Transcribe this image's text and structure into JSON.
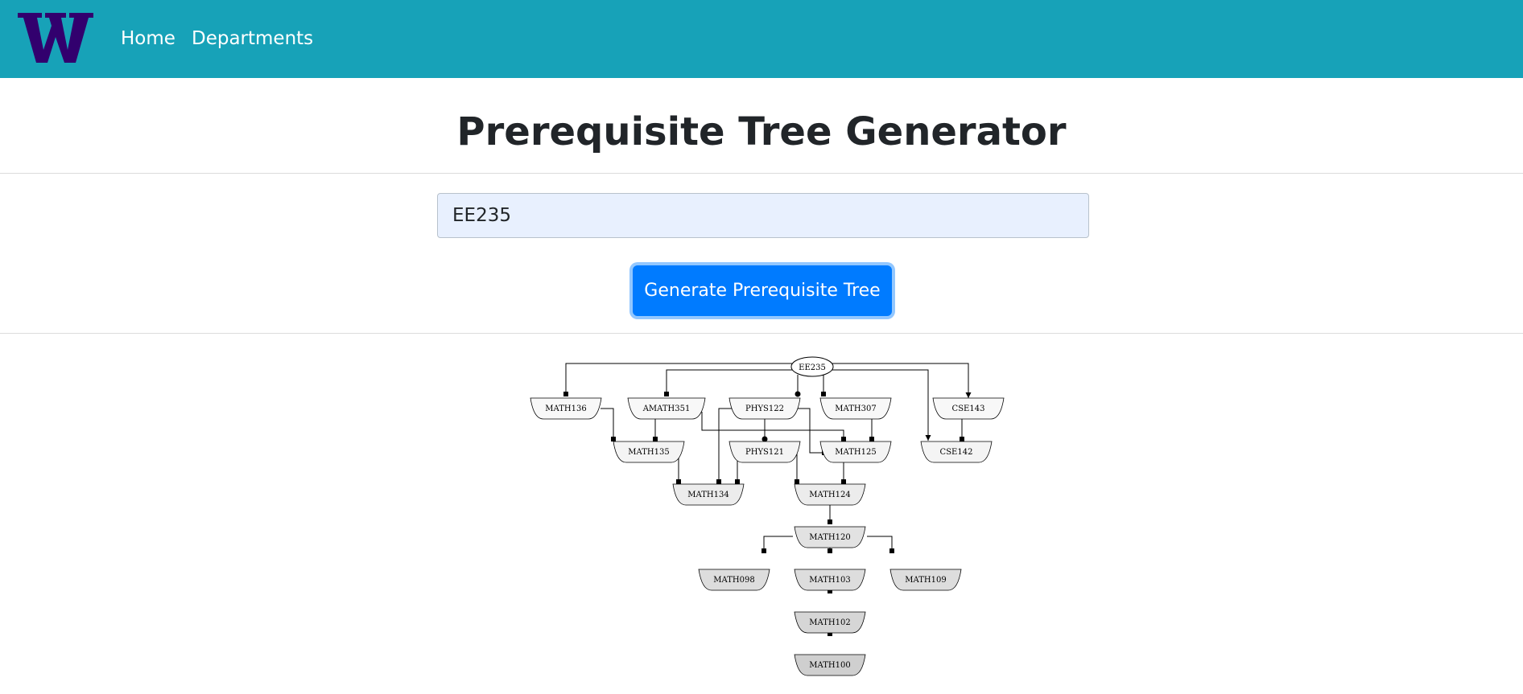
{
  "nav": {
    "logo_alt": "W",
    "home_label": "Home",
    "departments_label": "Departments",
    "brand_color": "#17a2b8",
    "logo_color": "#32006e"
  },
  "page": {
    "title": "Prerequisite Tree Generator"
  },
  "form": {
    "course_value": "EE235",
    "button_label": "Generate Prerequisite Tree",
    "button_color": "#007bff"
  },
  "tree": {
    "root": "EE235",
    "nodes": [
      "MATH136",
      "AMATH351",
      "PHYS122",
      "MATH307",
      "CSE143",
      "MATH135",
      "PHYS121",
      "MATH125",
      "CSE142",
      "MATH134",
      "MATH124",
      "MATH120",
      "MATH098",
      "MATH103",
      "MATH109",
      "MATH102",
      "MATH100"
    ],
    "edges": [
      {
        "from": "EE235",
        "to": "MATH136"
      },
      {
        "from": "EE235",
        "to": "AMATH351"
      },
      {
        "from": "EE235",
        "to": "PHYS122"
      },
      {
        "from": "EE235",
        "to": "MATH307"
      },
      {
        "from": "EE235",
        "to": "CSE143"
      },
      {
        "from": "EE235",
        "to": "CSE142"
      },
      {
        "from": "MATH136",
        "to": "MATH135"
      },
      {
        "from": "AMATH351",
        "to": "MATH135"
      },
      {
        "from": "AMATH351",
        "to": "MATH125"
      },
      {
        "from": "PHYS122",
        "to": "PHYS121"
      },
      {
        "from": "PHYS122",
        "to": "MATH125"
      },
      {
        "from": "PHYS122",
        "to": "MATH134"
      },
      {
        "from": "MATH307",
        "to": "MATH125"
      },
      {
        "from": "CSE143",
        "to": "CSE142"
      },
      {
        "from": "MATH135",
        "to": "MATH134"
      },
      {
        "from": "PHYS121",
        "to": "MATH134"
      },
      {
        "from": "PHYS121",
        "to": "MATH124"
      },
      {
        "from": "MATH125",
        "to": "MATH124"
      },
      {
        "from": "MATH124",
        "to": "MATH120"
      },
      {
        "from": "MATH120",
        "to": "MATH098"
      },
      {
        "from": "MATH120",
        "to": "MATH103"
      },
      {
        "from": "MATH120",
        "to": "MATH109"
      },
      {
        "from": "MATH103",
        "to": "MATH102"
      },
      {
        "from": "MATH102",
        "to": "MATH100"
      }
    ]
  }
}
